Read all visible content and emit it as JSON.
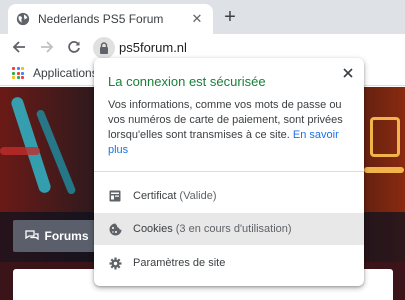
{
  "tab": {
    "title": "Nederlands PS5 Forum",
    "close_label": "✕",
    "newtab_label": "+"
  },
  "toolbar": {
    "url": "ps5forum.nl"
  },
  "bookmarks": {
    "apps_label": "Applications"
  },
  "site": {
    "forums_label": "Forums"
  },
  "popup": {
    "title": "La connexion est sécurisée",
    "description": "Vos informations, comme vos mots de passe ou vos numéros de carte de paiement, sont privées lorsqu'elles sont transmises à ce site.",
    "learn_more": "En savoir plus",
    "certificate_label": "Certificat",
    "certificate_status": "(Valide)",
    "cookies_label": "Cookies",
    "cookies_status": "(3 en cours d'utilisation)",
    "site_settings_label": "Paramètres de site"
  },
  "colors": {
    "secure_green": "#188038",
    "link_blue": "#1a73e8",
    "tab_strip": "#dee1e6"
  }
}
